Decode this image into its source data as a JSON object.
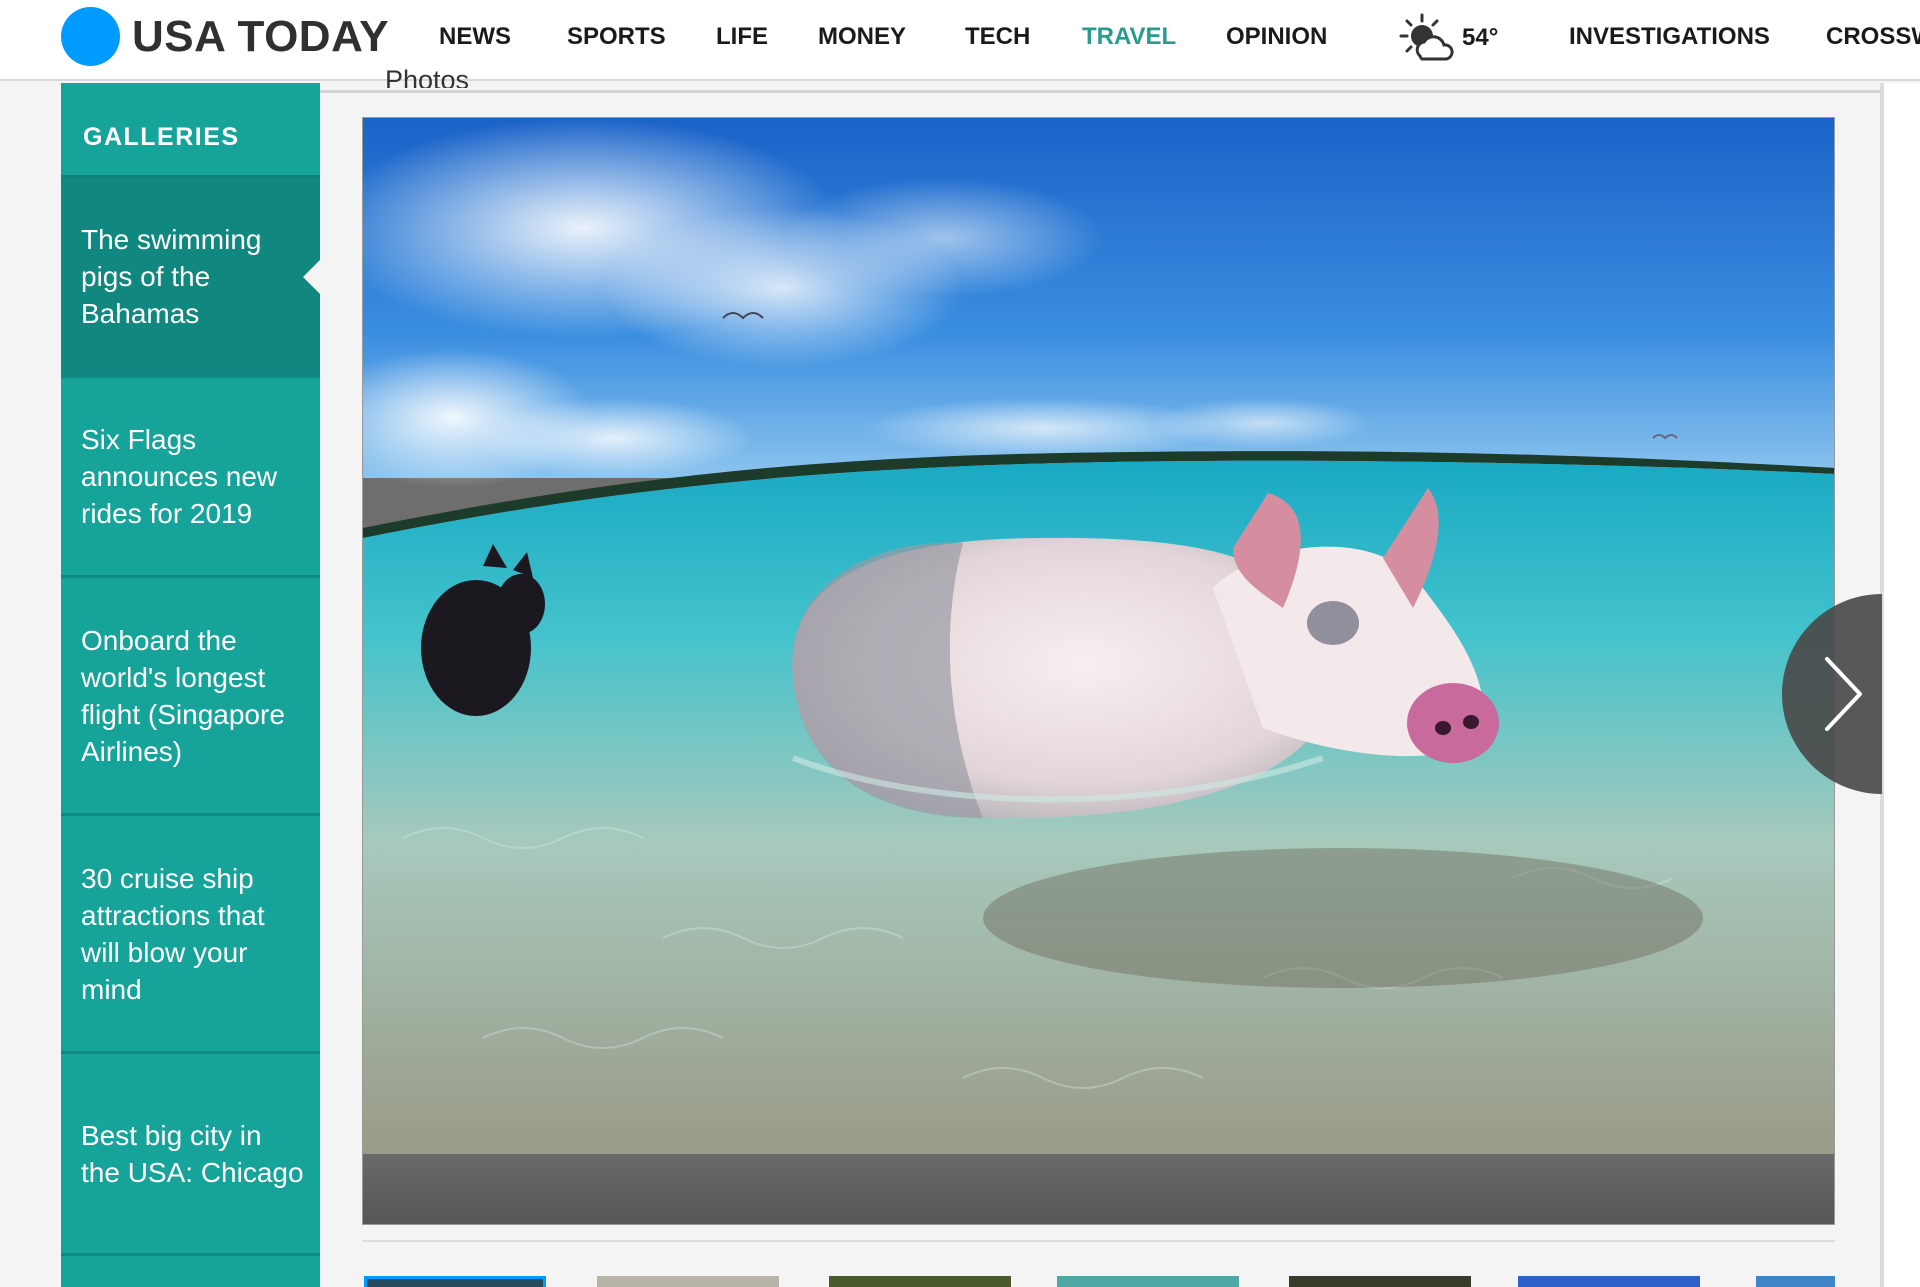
{
  "header": {
    "logo_text": "USA TODAY",
    "logo_color": "#009bff",
    "nav": [
      {
        "label": "NEWS",
        "active": false
      },
      {
        "label": "SPORTS",
        "active": false
      },
      {
        "label": "LIFE",
        "active": false
      },
      {
        "label": "MONEY",
        "active": false
      },
      {
        "label": "TECH",
        "active": false
      },
      {
        "label": "TRAVEL",
        "active": true
      },
      {
        "label": "OPINION",
        "active": false
      }
    ],
    "weather": {
      "icon": "partly-cloudy-icon",
      "temp": "54°"
    },
    "nav_right": [
      {
        "label": "INVESTIGATIONS"
      },
      {
        "label": "CROSSW"
      }
    ],
    "active_color": "#2b9a8f"
  },
  "sidebar": {
    "title": "GALLERIES",
    "bg_color": "#16a39a",
    "items": [
      {
        "label": "The swimming pigs of the Bahamas",
        "active": true
      },
      {
        "label": "Six Flags announces new rides for 2019",
        "active": false
      },
      {
        "label": "Onboard the world's longest flight (Singapore Airlines)",
        "active": false
      },
      {
        "label": "30 cruise ship attractions that will blow your mind",
        "active": false
      },
      {
        "label": "Best big city in the USA: Chicago",
        "active": false
      }
    ]
  },
  "main": {
    "section_label": "Photos",
    "next_icon": "chevron-right-icon",
    "thumbnails": [
      {
        "selected": true,
        "color": "#264a5e"
      },
      {
        "selected": false,
        "color": "#b9b4a8"
      },
      {
        "selected": false,
        "color": "#4a5a2a"
      },
      {
        "selected": false,
        "color": "#4fa8a6"
      },
      {
        "selected": false,
        "color": "#3a3a2a"
      },
      {
        "selected": false,
        "color": "#2f5fc9"
      },
      {
        "selected": false,
        "color": "#3f86c9"
      }
    ]
  }
}
